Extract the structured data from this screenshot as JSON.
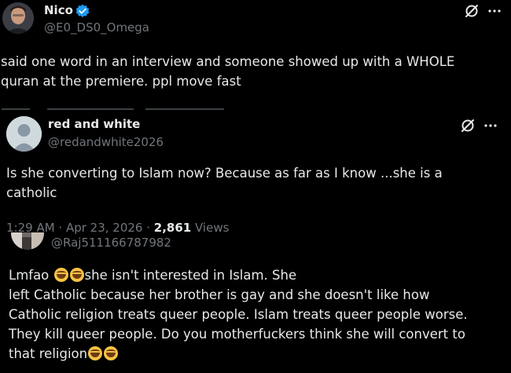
{
  "post1": {
    "name": "Nico",
    "handle": "@E0_DS0_Omega",
    "text": "said one word in an interview and someone showed up with a WHOLE quran at the premiere. ppl move fast",
    "verified": true
  },
  "post2": {
    "name": "red and white",
    "handle": "@redandwhite2026",
    "text": "Is she converting to Islam now? Because as far as I know ...she is a catholic",
    "time": "1:29 AM · Apr 23, 2026 · ",
    "views_count": "2,861",
    "views_label": " Views"
  },
  "post3": {
    "handle": "@Raj511166787982",
    "line1_a": "Lmfao ",
    "line1_b": "she isn't interested in Islam. She",
    "line2": "left Catholic because her brother is gay and she doesn't like how",
    "line3": "Catholic religion treats queer people. Islam treats queer people worse.",
    "line4": "They kill queer people. Do you motherfuckers think she will convert to",
    "line5": "that religion"
  },
  "icons": {
    "grok": "grok-icon",
    "more": "more-icon",
    "verified": "verified-badge-icon",
    "emoji": "rolling-on-floor-laughing-emoji"
  },
  "colors": {
    "background": "#000000",
    "text": "#e7e9ea",
    "muted": "#71767b",
    "verified": "#1d9bf0"
  }
}
